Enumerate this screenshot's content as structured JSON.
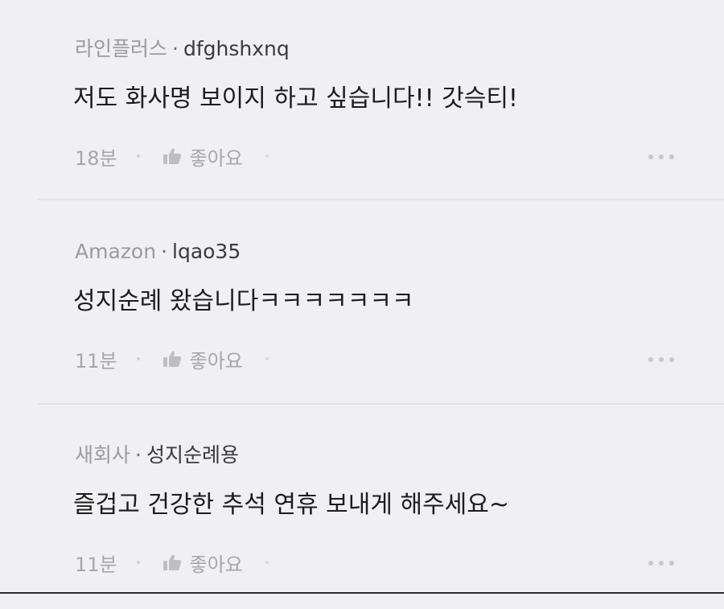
{
  "comments": [
    {
      "company": "라인플러스",
      "separator": "·",
      "nickname": "dfghshxnq",
      "text": "저도 화사명 보이지 하고 싶습니다!! 갓슥티!",
      "time": "18분",
      "like_label": "좋아요",
      "like_icon": "thumbs-up-icon",
      "more_icon": "more-dots-icon"
    },
    {
      "company": "Amazon",
      "separator": "·",
      "nickname": "lqao35",
      "text": "성지순례 왔습니다ㅋㅋㅋㅋㅋㅋㅋ",
      "time": "11분",
      "like_label": "좋아요",
      "like_icon": "thumbs-up-icon",
      "more_icon": "more-dots-icon"
    },
    {
      "company": "새회사",
      "separator": "·",
      "nickname": "성지순례용",
      "text": "즐겁고 건강한 추석 연휴 보내게 해주세요~",
      "time": "11분",
      "like_label": "좋아요",
      "like_icon": "thumbs-up-icon",
      "more_icon": "more-dots-icon"
    }
  ],
  "colors": {
    "background": "#f0f0f2",
    "text_primary": "#1c1c1e",
    "text_muted": "#a0a0a6",
    "divider": "#e3e3e7"
  }
}
